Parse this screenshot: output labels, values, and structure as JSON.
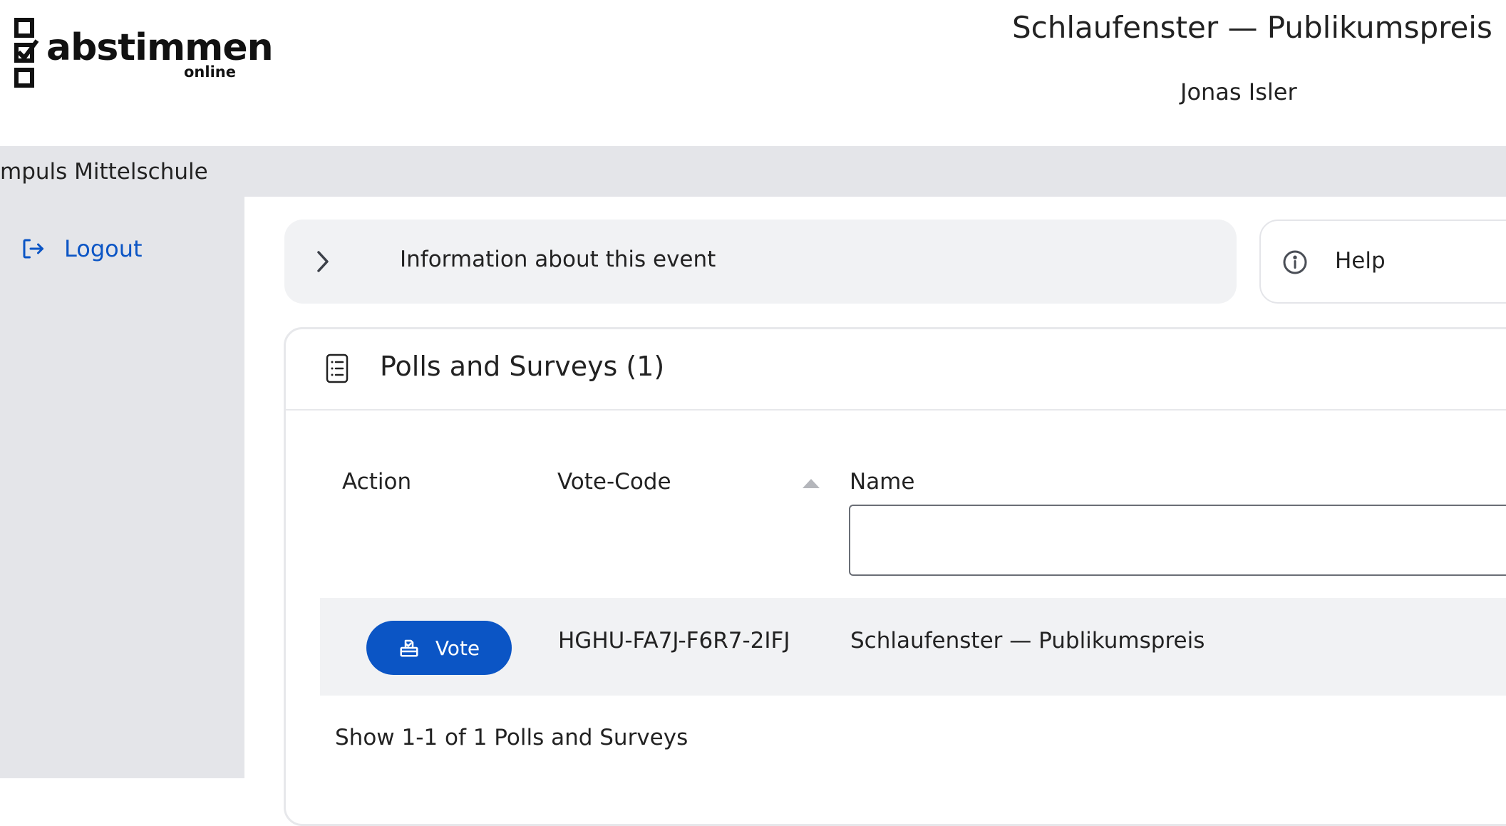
{
  "header": {
    "logo_text": "abstimmen",
    "logo_subtext": "online",
    "event_title": "Schlaufenster — Publikumspreis",
    "user_name": "Jonas Isler"
  },
  "org_bar": {
    "org_name": "mpuls Mittelschule"
  },
  "sidebar": {
    "logout_label": "Logout"
  },
  "info_bar": {
    "label": "Information about this event"
  },
  "help": {
    "label": "Help"
  },
  "polls": {
    "title": "Polls and Surveys (1)",
    "columns": {
      "action": "Action",
      "vote_code": "Vote-Code",
      "name": "Name"
    },
    "name_filter_value": "",
    "rows": [
      {
        "action_label": "Vote",
        "vote_code": "HGHU-FA7J-F6R7-2IFJ",
        "name": "Schlaufenster — Publikumspreis"
      }
    ],
    "pagination": "Show 1-1 of 1 Polls and Surveys"
  },
  "colors": {
    "accent": "#0b55c5",
    "sidebar_bg": "#e4e5e9",
    "row_bg": "#f1f2f4"
  },
  "icons": {
    "logo": "checklist-logo-icon",
    "logout": "logout-icon",
    "chevron": "chevron-right-icon",
    "help": "info-icon",
    "polls": "list-document-icon",
    "vote": "ballot-box-icon",
    "sort": "sort-ascending-icon"
  }
}
